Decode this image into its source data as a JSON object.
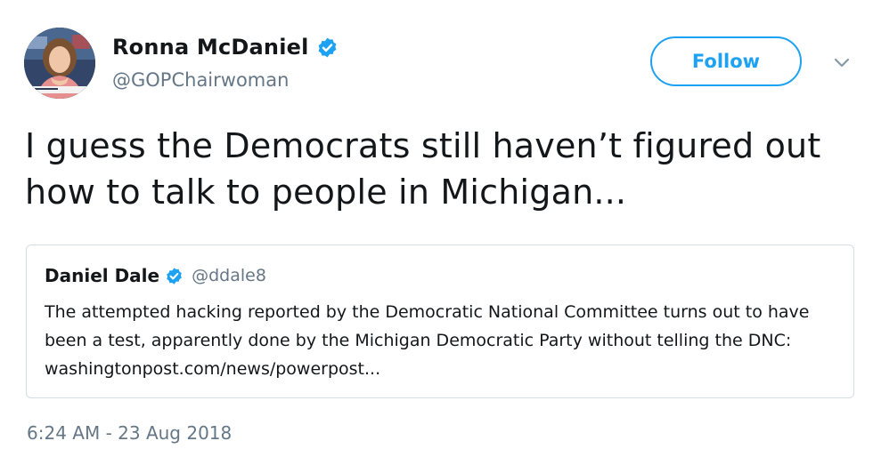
{
  "author": {
    "display_name": "Ronna McDaniel",
    "handle": "@GOPChairwoman",
    "verified": true,
    "avatar": "profile-photo"
  },
  "follow_button": {
    "label": "Follow"
  },
  "caret": {
    "icon": "chevron-down-icon"
  },
  "tweet": {
    "text": "I guess the Democrats still haven’t figured out how to talk to people in Michigan..."
  },
  "quoted_tweet": {
    "display_name": "Daniel Dale",
    "handle": "@ddale8",
    "verified": true,
    "text": "The attempted hacking reported by the Democratic National Committee turns out to have been a test, apparently done by the Michigan Democratic Party without telling the DNC: washingtonpost.com/news/powerpost..."
  },
  "timestamp": "6:24 AM - 23 Aug 2018",
  "colors": {
    "accent": "#1da1f2",
    "text": "#14171a",
    "secondary_text": "#657786",
    "border": "#d6dde3"
  }
}
